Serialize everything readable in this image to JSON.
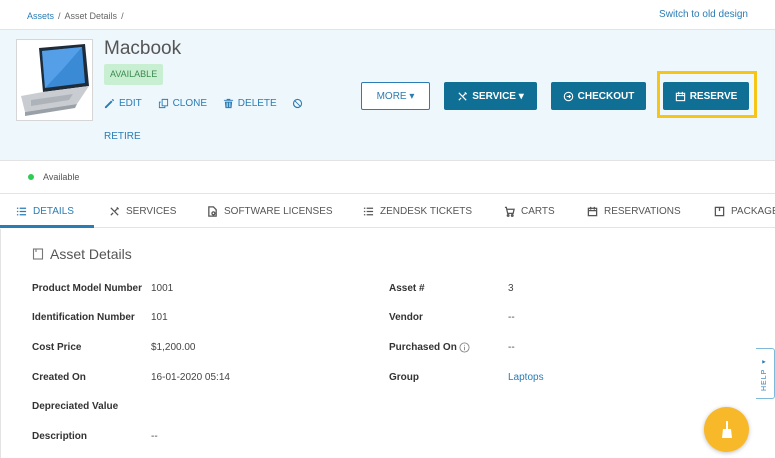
{
  "breadcrumb": [
    "Assets",
    "Asset Details"
  ],
  "switch_link": "Switch to old design",
  "asset": {
    "name": "Macbook",
    "status_pill": "AVAILABLE"
  },
  "actions": {
    "edit": "EDIT",
    "clone": "CLONE",
    "delete": "DELETE",
    "retire": "RETIRE"
  },
  "buttons": {
    "more": "MORE ▾",
    "service": "SERVICE ▾",
    "checkout": "CHECKOUT",
    "reserve": "RESERVE"
  },
  "status_row": {
    "text": "Available",
    "dot_color": "#2ecc52"
  },
  "tabs": [
    "DETAILS",
    "SERVICES",
    "SOFTWARE LICENSES",
    "ZENDESK TICKETS",
    "CARTS",
    "RESERVATIONS",
    "PACKAGE"
  ],
  "section_title": "Asset Details",
  "fields_left": [
    {
      "label": "Product Model Number",
      "value": "1001"
    },
    {
      "label": "Identification Number",
      "value": "101"
    },
    {
      "label": "Cost Price",
      "value": "$1,200.00"
    },
    {
      "label": "Created On",
      "value": "16-01-2020 05:14"
    },
    {
      "label": "Depreciated Value",
      "value": ""
    },
    {
      "label": "Description",
      "value": "--"
    }
  ],
  "fields_right": [
    {
      "label": "Asset #",
      "value": "3"
    },
    {
      "label": "Vendor",
      "value": "--"
    },
    {
      "label": "Purchased On",
      "value": "--"
    },
    {
      "label": "Group",
      "value": "Laptops"
    }
  ],
  "help_tab": "HELP ◂",
  "colors": {
    "primary": "#0f6f94",
    "link": "#2a7cb5",
    "highlight": "#f5c518",
    "fab": "#f7b82a"
  }
}
